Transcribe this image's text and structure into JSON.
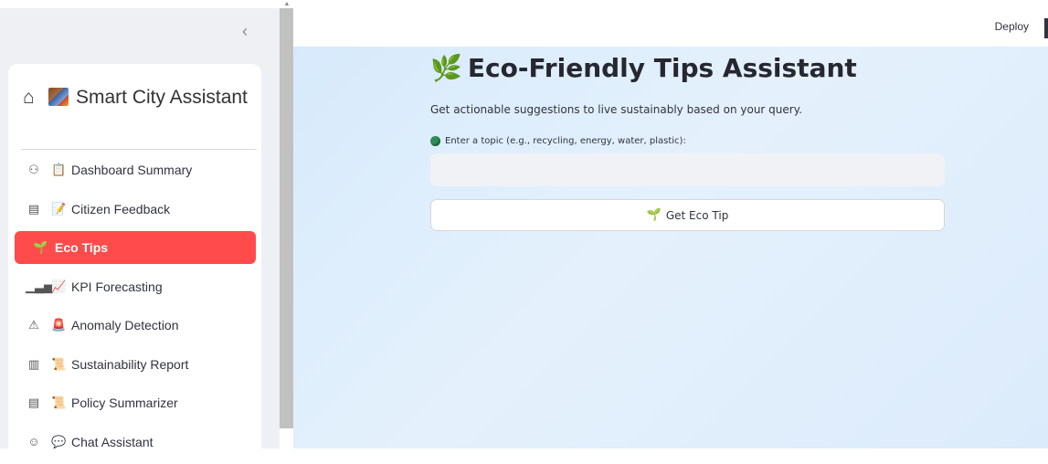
{
  "sidebar": {
    "collapse_icon": "chevron-left-icon",
    "collapse_glyph": "‹",
    "header": {
      "home_glyph": "⌂",
      "title": "Smart City Assistant"
    },
    "items": [
      {
        "icon1": "⚇",
        "icon2": "📋",
        "label": "Dashboard Summary",
        "active": false
      },
      {
        "icon1": "▤",
        "icon2": "📝",
        "label": "Citizen Feedback",
        "active": false
      },
      {
        "icon1": "",
        "icon2": "🌱",
        "label": "Eco Tips",
        "active": true
      },
      {
        "icon1": "▁▃▅",
        "icon2": "📈",
        "label": "KPI Forecasting",
        "active": false
      },
      {
        "icon1": "⚠",
        "icon2": "🚨",
        "label": "Anomaly Detection",
        "active": false
      },
      {
        "icon1": "▥",
        "icon2": "📜",
        "label": "Sustainability Report",
        "active": false
      },
      {
        "icon1": "▤",
        "icon2": "📜",
        "label": "Policy Summarizer",
        "active": false
      },
      {
        "icon1": "☺",
        "icon2": "💬",
        "label": "Chat Assistant",
        "active": false
      }
    ],
    "active_color": "#ff4b4b"
  },
  "header": {
    "deploy_label": "Deploy"
  },
  "main": {
    "title_icon": "🌿",
    "title": "Eco-Friendly Tips Assistant",
    "subtitle": "Get actionable suggestions to live sustainably based on your query.",
    "input_label": "Enter a topic (e.g., recycling, energy, water, plastic):",
    "input_value": "",
    "input_placeholder": "",
    "button_icon": "🌱",
    "button_label": "Get Eco Tip"
  }
}
